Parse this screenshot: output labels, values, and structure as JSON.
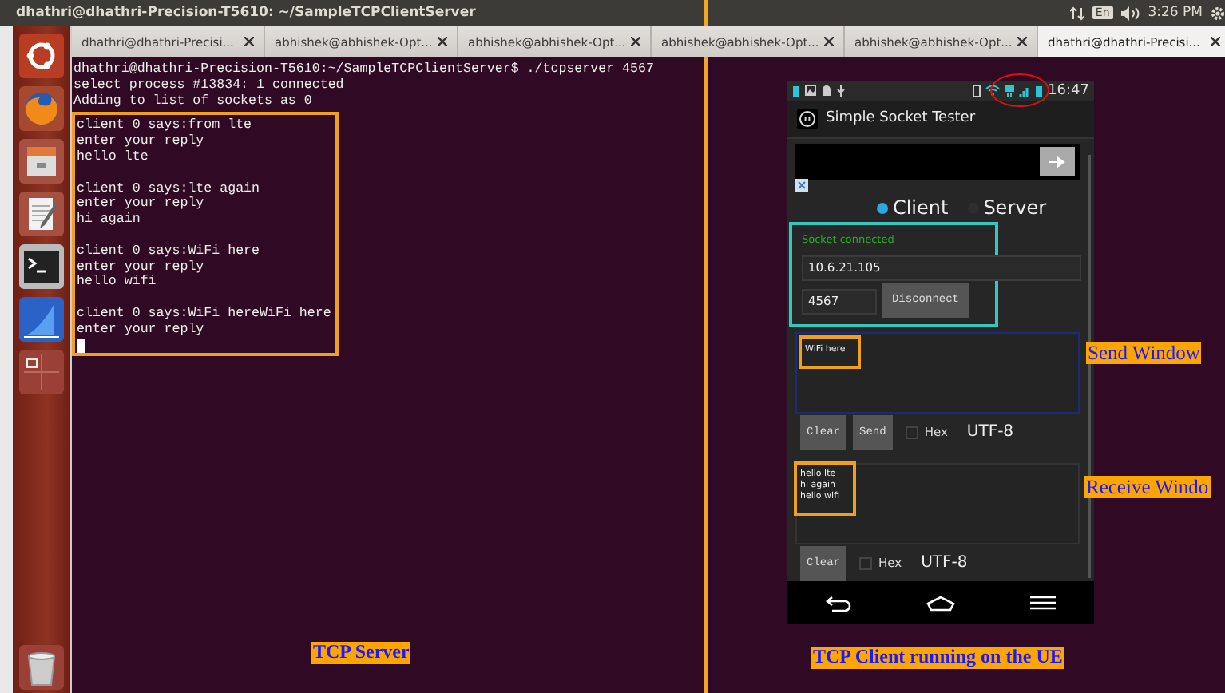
{
  "top_bar": {
    "title": "dhathri@dhathri-Precision-T5610: ~/SampleTCPClientServer",
    "keyboard_layout": "En",
    "clock": "3:26 PM"
  },
  "tabs": [
    {
      "label": "dhathri@dhathri-Precisi...",
      "selected": false
    },
    {
      "label": "abhishek@abhishek-Opt...",
      "selected": false
    },
    {
      "label": "abhishek@abhishek-Opt...",
      "selected": false
    },
    {
      "label": "abhishek@abhishek-Opt...",
      "selected": false
    },
    {
      "label": "abhishek@abhishek-Opt...",
      "selected": false
    },
    {
      "label": "dhathri@dhathri-Precisi...",
      "selected": true
    }
  ],
  "terminal": {
    "header_lines": [
      "dhathri@dhathri-Precision-T5610:~/SampleTCPClientServer$ ./tcpserver 4567",
      "select process #13834: 1 connected",
      "Adding to list of sockets as 0"
    ],
    "exchanges": [
      [
        "client 0 says:from lte",
        "enter your reply",
        "hello lte"
      ],
      [
        "client 0 says:lte again",
        "enter your reply",
        "hi again"
      ],
      [
        "client 0 says:WiFi here",
        "enter your reply",
        "hello wifi"
      ],
      [
        "client 0 says:WiFi hereWiFi here",
        "enter your reply"
      ]
    ]
  },
  "phone": {
    "status_time": "16:47",
    "app_title": "Simple Socket Tester",
    "modes": [
      {
        "label": "Client",
        "selected": true
      },
      {
        "label": "Server",
        "selected": false
      }
    ],
    "connection_status": "Socket connected",
    "host": "10.6.21.105",
    "port": "4567",
    "connect_button": "Disconnect",
    "send": {
      "text": "WiFi here",
      "buttons": [
        "Clear",
        "Send"
      ],
      "hex_label": "Hex",
      "hex_checked": false,
      "encoding": "UTF-8"
    },
    "receive": {
      "lines": [
        "hello lte",
        "hi again",
        "hello wifi"
      ],
      "buttons": [
        "Clear"
      ],
      "hex_label": "Hex",
      "hex_checked": false,
      "encoding": "UTF-8"
    }
  },
  "annotations": [
    {
      "kind": "caption",
      "text": "TCP Server"
    },
    {
      "kind": "caption",
      "text": "TCP Client running on the UE"
    },
    {
      "kind": "label",
      "text": "Send Window"
    },
    {
      "kind": "label",
      "text": "Receive Windo"
    }
  ]
}
